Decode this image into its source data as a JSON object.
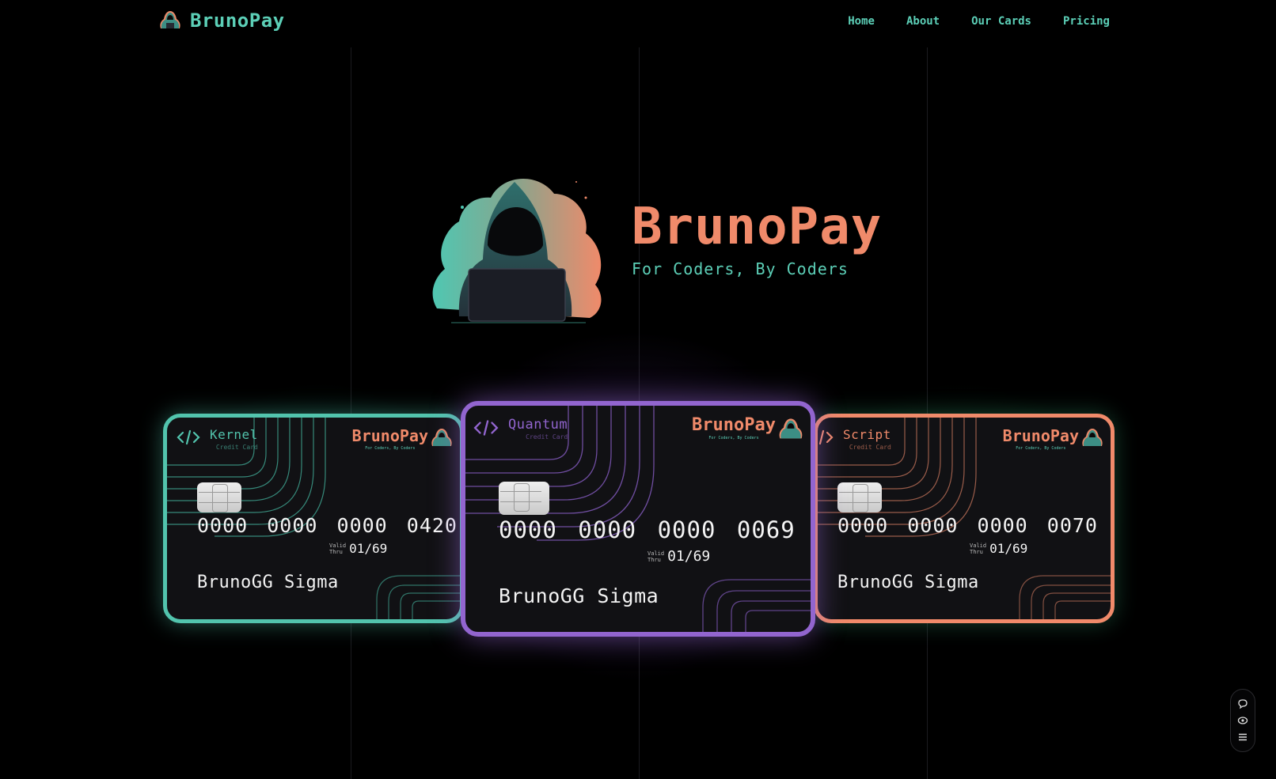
{
  "nav": {
    "brand": "BrunoPay",
    "links": [
      {
        "label": "Home"
      },
      {
        "label": "About"
      },
      {
        "label": "Our Cards"
      },
      {
        "label": "Pricing"
      }
    ]
  },
  "hero": {
    "title": "BrunoPay",
    "subtitle": "For Coders, By Coders"
  },
  "cards": {
    "kernel": {
      "type": "Kernel",
      "type_sub": "Credit Card",
      "brand": "BrunoPay",
      "tagline": "For Coders, By Coders",
      "number": "0000 0000 0000 0420",
      "valid_label_1": "Valid",
      "valid_label_2": "Thru",
      "valid_date": "01/69",
      "holder": "BrunoGG Sigma",
      "accent": "#52c4ad"
    },
    "quantum": {
      "type": "Quantum",
      "type_sub": "Credit Card",
      "brand": "BrunoPay",
      "tagline": "For Coders, By Coders",
      "number": "0000 0000 0000 0069",
      "valid_label_1": "Valid",
      "valid_label_2": "Thru",
      "valid_date": "01/69",
      "holder": "BrunoGG Sigma",
      "accent": "#9265cf"
    },
    "script": {
      "type": "Script",
      "type_sub": "Credit Card",
      "brand": "BrunoPay",
      "tagline": "For Coders, By Coders",
      "number": "0000 0000 0000 0070",
      "valid_label_1": "Valid",
      "valid_label_2": "Thru",
      "valid_date": "01/69",
      "holder": "BrunoGG Sigma",
      "accent": "#f08a6a"
    }
  },
  "dock": {
    "icons": [
      "chat-icon",
      "eye-icon",
      "menu-icon"
    ]
  },
  "colors": {
    "background": "#000000",
    "teal": "#5ccfb7",
    "orange": "#f08a6a",
    "purple": "#9265cf"
  }
}
